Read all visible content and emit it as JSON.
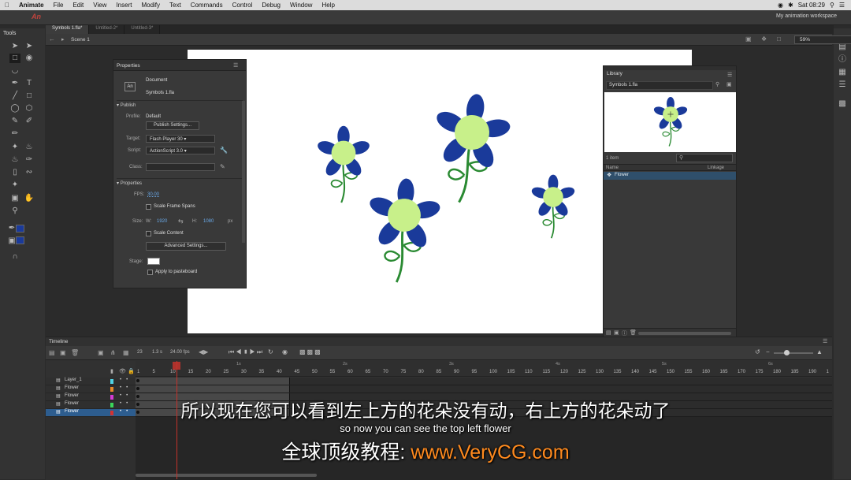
{
  "menubar": {
    "app": "Animate",
    "items": [
      "File",
      "Edit",
      "View",
      "Insert",
      "Modify",
      "Text",
      "Commands",
      "Control",
      "Debug",
      "Window",
      "Help"
    ],
    "clock": "Sat 08:29"
  },
  "appbar": {
    "logo": "An",
    "workspace": "My animation workspace"
  },
  "tools": {
    "header": "Tools"
  },
  "tabs": [
    "Symbols 1.fla*",
    "Untitled-2*",
    "Untitled-3*"
  ],
  "scene": {
    "name": "Scene 1",
    "zoom": "59%"
  },
  "properties": {
    "title": "Properties",
    "doc_label": "Document",
    "doc_name": "Symbols 1.fla",
    "publish_header": "Publish",
    "profile_label": "Profile:",
    "profile_value": "Default",
    "publish_settings": "Publish Settings...",
    "target_label": "Target:",
    "target_value": "Flash Player 30",
    "script_label": "Script:",
    "script_value": "ActionScript 3.0",
    "class_label": "Class:",
    "props_header": "Properties",
    "fps_label": "FPS:",
    "fps_value": "30.00",
    "scale_frame_spans": "Scale Frame Spans",
    "size_label": "Size:",
    "w_label": "W:",
    "w_value": "1920",
    "h_label": "H:",
    "h_value": "1080",
    "unit": "px",
    "scale_content": "Scale Content",
    "advanced_settings": "Advanced Settings...",
    "stage_label": "Stage:",
    "apply_pasteboard": "Apply to pasteboard"
  },
  "library": {
    "title": "Library",
    "doc": "Symbols 1.fla",
    "count": "1 item",
    "col_name": "Name",
    "col_linkage": "Linkage",
    "item": "Flower"
  },
  "timeline": {
    "title": "Timeline",
    "frame_current": "23",
    "time": "1.3 s",
    "fps": "24.00 fps",
    "seconds": [
      "1s",
      "2s",
      "3s",
      "4s",
      "5s",
      "6s"
    ],
    "ticks": [
      "1",
      "5",
      "10",
      "15",
      "20",
      "25",
      "30",
      "35",
      "40",
      "45",
      "50",
      "55",
      "60",
      "65",
      "70",
      "75",
      "80",
      "85",
      "90",
      "95",
      "100",
      "105",
      "110",
      "115",
      "120",
      "125",
      "130",
      "135",
      "140",
      "145",
      "150",
      "155",
      "160",
      "165",
      "170",
      "175",
      "180",
      "185",
      "190",
      "1"
    ],
    "layers": [
      {
        "name": "Layer_1",
        "color": "#4fd3e6"
      },
      {
        "name": "Flower",
        "color": "#e98a2a"
      },
      {
        "name": "Flower",
        "color": "#d63bd6"
      },
      {
        "name": "Flower",
        "color": "#3bd65a"
      },
      {
        "name": "Flower",
        "color": "#d23232"
      }
    ]
  },
  "subtitles": {
    "cn": "所以现在您可以看到左上方的花朵没有动，右上方的花朵动了",
    "en": "so now you can see the top left flower",
    "brand_cn": "全球顶级教程:",
    "brand_url": "www.VeryCG.com"
  },
  "colors": {
    "petal": "#1a3a9a",
    "center": "#c8f08a",
    "stem": "#2a8a32",
    "playhead": "#c3322b"
  }
}
